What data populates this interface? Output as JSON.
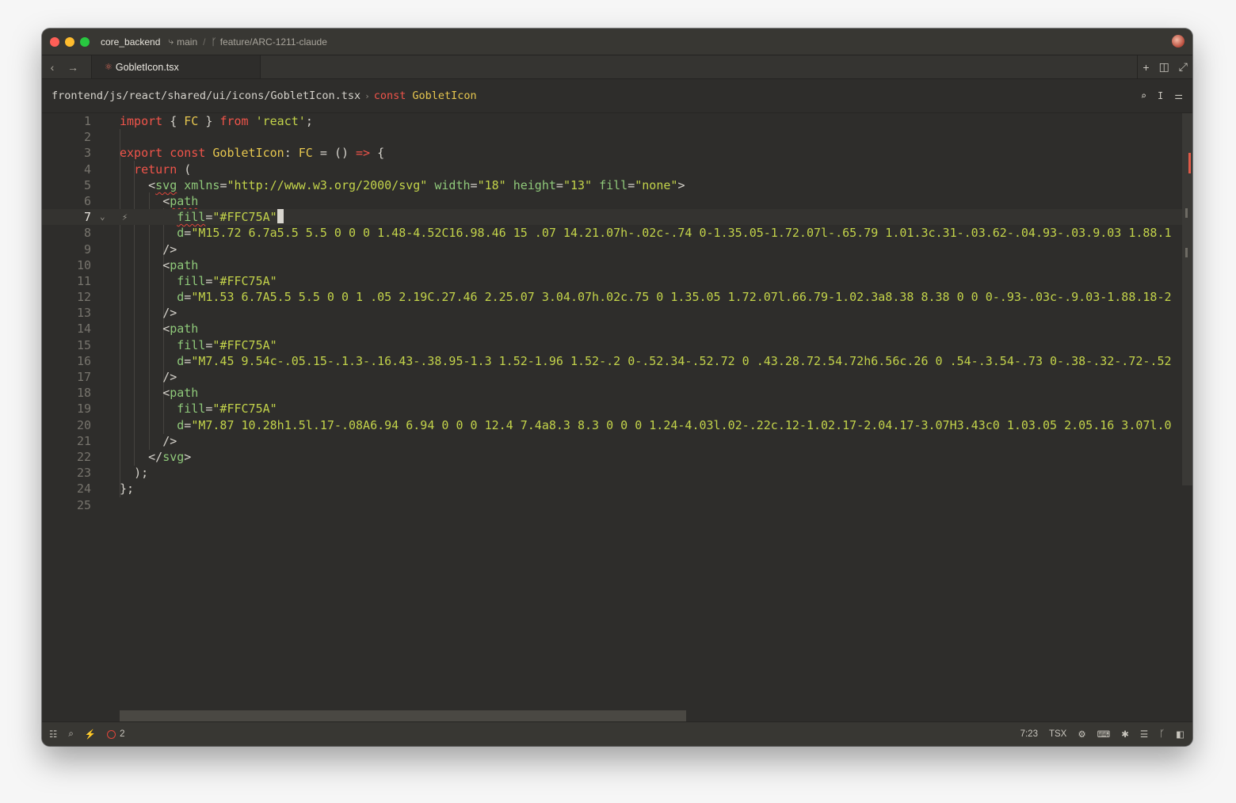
{
  "titlebar": {
    "project": "core_backend",
    "branch_base": "main",
    "branch_feature": "feature/ARC-1211-claude"
  },
  "tabs": [
    {
      "label": "GobletIcon.tsx",
      "icon": "react-file-icon"
    }
  ],
  "breadcrumb": {
    "path": "frontend/js/react/shared/ui/icons/GobletIcon.tsx",
    "keyword": "const",
    "symbol": "GobletIcon"
  },
  "editor": {
    "active_line": 7,
    "line_numbers": [
      "1",
      "2",
      "3",
      "4",
      "5",
      "6",
      "7",
      "8",
      "9",
      "10",
      "11",
      "12",
      "13",
      "14",
      "15",
      "16",
      "17",
      "18",
      "19",
      "20",
      "21",
      "22",
      "23",
      "24",
      "25"
    ],
    "fill_color": "\"#FFC75A\"",
    "path1_d": "\"M15.72 6.7a5.5 5.5 0 0 0 1.48-4.52C16.98.46 15 .07 14.21.07h-.02c-.74 0-1.35.05-1.72.07l-.65.79 1.01.3c.31-.03.62-.04.93-.03.9.03 1.88.1",
    "path2_d": "\"M1.53 6.7A5.5 5.5 0 0 1 .05 2.19C.27.46 2.25.07 3.04.07h.02c.75 0 1.35.05 1.72.07l.66.79-1.02.3a8.38 8.38 0 0 0-.93-.03c-.9.03-1.88.18-2",
    "path3_d": "\"M7.45 9.54c-.05.15-.1.3-.16.43-.38.95-1.3 1.52-1.96 1.52-.2 0-.52.34-.52.72 0 .43.28.72.54.72h6.56c.26 0 .54-.3.54-.73 0-.38-.32-.72-.52",
    "path4_d": "\"M7.87 10.28h1.5l.17-.08A6.94 6.94 0 0 0 12.4 7.4a8.3 8.3 0 0 0 1.24-4.03l.02-.22c.12-1.02.17-2.04.17-3.07H3.43c0 1.03.05 2.05.16 3.07l.0"
  },
  "status": {
    "errors": "2",
    "cursor_pos": "7:23",
    "language": "TSX"
  },
  "colors": {
    "keyword": "#f0544a",
    "type": "#e7c74f",
    "string": "#c3d34a",
    "tag": "#8fc97a"
  }
}
